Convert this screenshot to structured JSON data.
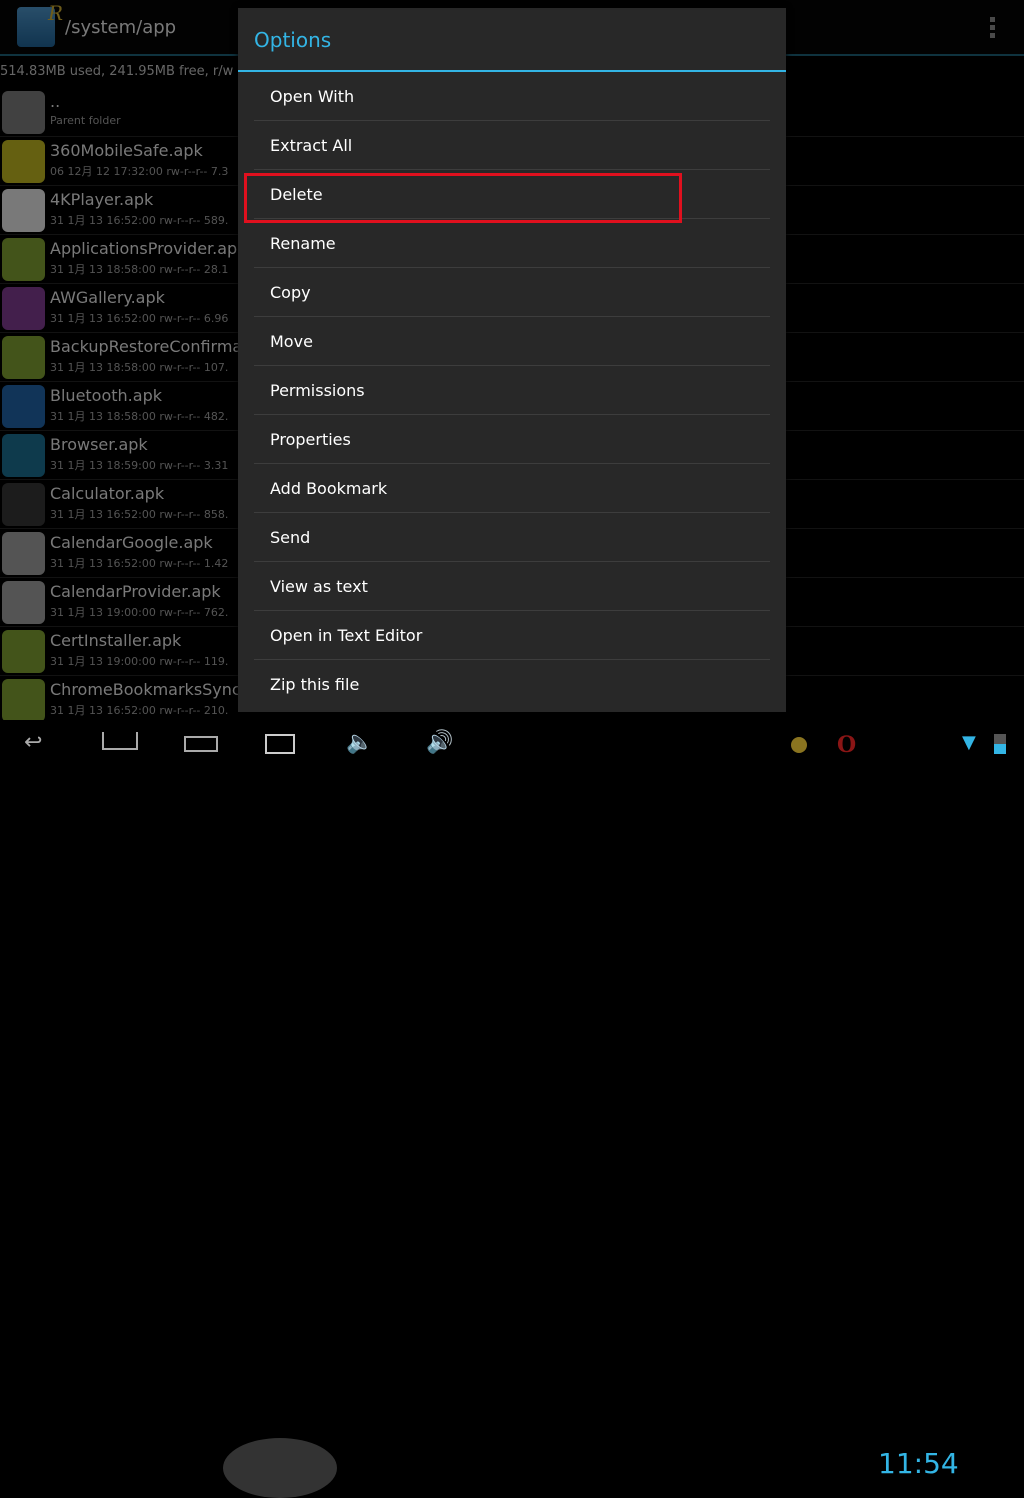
{
  "header": {
    "path": "/system/app",
    "usage": "514.83MB used, 241.95MB free, r/w",
    "logo_letter": "R"
  },
  "files": [
    {
      "name": "..",
      "meta": "Parent folder",
      "icon": "folder-icon"
    },
    {
      "name": "360MobileSafe.apk",
      "meta": "06 12月 12 17:32:00  rw-r--r--  7.3",
      "icon": "360-icon"
    },
    {
      "name": "4KPlayer.apk",
      "meta": "31 1月 13 16:52:00  rw-r--r--  589.",
      "icon": "4k-icon"
    },
    {
      "name": "ApplicationsProvider.apk",
      "meta": "31 1月 13 18:58:00  rw-r--r--  28.1",
      "icon": "android-icon"
    },
    {
      "name": "AWGallery.apk",
      "meta": "31 1月 13 16:52:00  rw-r--r--  6.96",
      "icon": "gallery-icon"
    },
    {
      "name": "BackupRestoreConfirmat",
      "meta": "31 1月 13 18:58:00  rw-r--r--  107.",
      "icon": "android-icon"
    },
    {
      "name": "Bluetooth.apk",
      "meta": "31 1月 13 18:58:00  rw-r--r--  482.",
      "icon": "bluetooth-icon"
    },
    {
      "name": "Browser.apk",
      "meta": "31 1月 13 18:59:00  rw-r--r--  3.31",
      "icon": "globe-icon"
    },
    {
      "name": "Calculator.apk",
      "meta": "31 1月 13 16:52:00  rw-r--r--  858.",
      "icon": "calculator-icon"
    },
    {
      "name": "CalendarGoogle.apk",
      "meta": "31 1月 13 16:52:00  rw-r--r--  1.42",
      "icon": "calendar-icon"
    },
    {
      "name": "CalendarProvider.apk",
      "meta": "31 1月 13 19:00:00  rw-r--r--  762.",
      "icon": "calendar-icon"
    },
    {
      "name": "CertInstaller.apk",
      "meta": "31 1月 13 19:00:00  rw-r--r--  119.",
      "icon": "android-icon"
    },
    {
      "name": "ChromeBookmarksSyncA",
      "meta": "31 1月 13 16:52:00  rw-r--r--  210.",
      "icon": "android-icon"
    }
  ],
  "dialog": {
    "title": "Options",
    "items": [
      "Open With",
      "Extract All",
      "Delete",
      "Rename",
      "Copy",
      "Move",
      "Permissions",
      "Properties",
      "Add Bookmark",
      "Send",
      "View as text",
      "Open in Text Editor",
      "Zip this file"
    ],
    "highlighted": "Delete"
  },
  "status": {
    "time": "11:54",
    "accent": "#33b5e5"
  }
}
